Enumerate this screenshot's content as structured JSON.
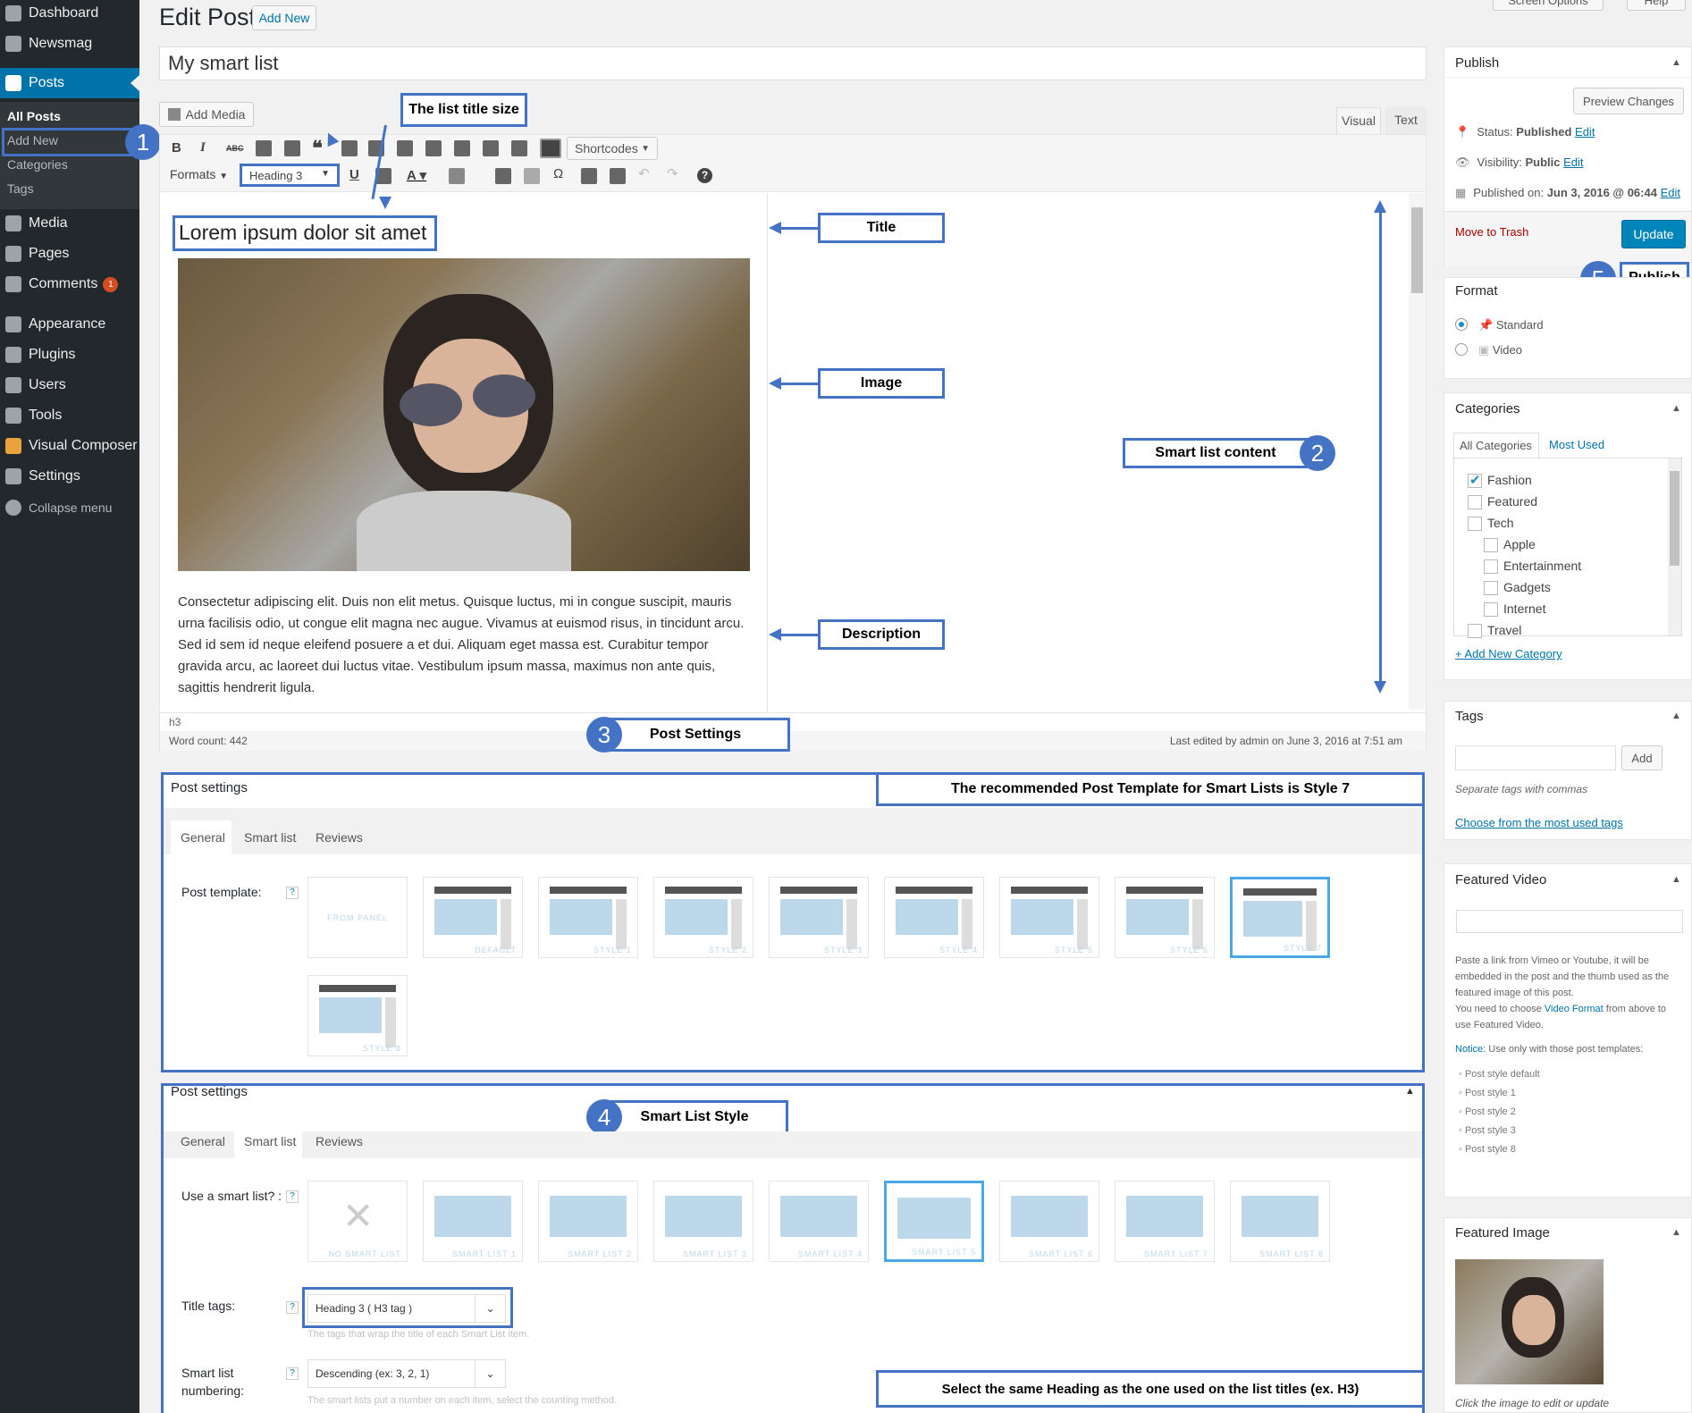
{
  "sidebar": {
    "items": [
      {
        "label": "Dashboard",
        "icon": "dashboard-icon"
      },
      {
        "label": "Newsmag",
        "icon": "newsmag-icon"
      },
      {
        "label": "Posts",
        "icon": "pin-icon"
      },
      {
        "label": "Media",
        "icon": "media-icon"
      },
      {
        "label": "Pages",
        "icon": "pages-icon"
      },
      {
        "label": "Comments",
        "icon": "comments-icon",
        "badge": "1"
      },
      {
        "label": "Appearance",
        "icon": "appearance-icon"
      },
      {
        "label": "Plugins",
        "icon": "plugins-icon"
      },
      {
        "label": "Users",
        "icon": "users-icon"
      },
      {
        "label": "Tools",
        "icon": "tools-icon"
      },
      {
        "label": "Visual Composer",
        "icon": "visual-composer-icon"
      },
      {
        "label": "Settings",
        "icon": "settings-icon"
      },
      {
        "label": "Collapse menu",
        "icon": "collapse-icon"
      }
    ],
    "submenu": [
      "All Posts",
      "Add New",
      "Categories",
      "Tags"
    ]
  },
  "header": {
    "title": "Edit Post",
    "add_new": "Add New",
    "screen_options": "Screen Options",
    "help": "Help"
  },
  "editor": {
    "post_title": "My smart list",
    "add_media": "Add Media",
    "tab_visual": "Visual",
    "tab_text": "Text",
    "shortcodes": "Shortcodes",
    "formats": "Formats",
    "heading_select": "Heading 3",
    "content_heading": "Lorem ipsum dolor sit amet",
    "paragraph": "Consectetur adipiscing elit. Duis non elit metus. Quisque luctus, mi in congue suscipit, mauris urna facilisis odio, ut congue elit magna nec augue. Vivamus at euismod risus, in tincidunt arcu. Sed id sem id neque eleifend posuere a et dui. Aliquam eget massa est. Curabitur tempor gravida arcu, ac laoreet dui luctus vitae. Vestibulum ipsum massa, maximus non ante quis, sagittis hendrerit ligula.",
    "path": "h3",
    "word_count": "Word count: 442",
    "last_edited": "Last edited by admin on June 3, 2016 at 7:51 am"
  },
  "callouts": {
    "title_size": "The list title size",
    "title": "Title",
    "image": "Image",
    "description": "Description",
    "smart_list_content": "Smart list content",
    "post_settings": "Post Settings",
    "recommended": "The recommended Post Template for Smart Lists is Style 7",
    "smart_list_style": "Smart List Style",
    "publish": "Publish",
    "select_heading": "Select the same Heading as the one used on the list titles (ex. H3)",
    "n1": "1",
    "n2": "2",
    "n3": "3",
    "n4": "4",
    "n5": "5"
  },
  "post_settings_1": {
    "title": "Post settings",
    "tabs": [
      "General",
      "Smart list",
      "Reviews"
    ],
    "post_template_label": "Post template:",
    "help": "?",
    "templates": [
      "FROM PANEL",
      "DEFAULT",
      "STYLE 1",
      "STYLE 2",
      "STYLE 3",
      "STYLE 4",
      "STYLE 5",
      "STYLE 6",
      "STYLE 7",
      "STYLE 8"
    ]
  },
  "post_settings_2": {
    "title": "Post settings",
    "tabs": [
      "General",
      "Smart list",
      "Reviews"
    ],
    "use_smart_list_label": "Use a smart list? :",
    "smart_lists": [
      "NO SMART LIST",
      "SMART LIST 1",
      "SMART LIST 2",
      "SMART LIST 3",
      "SMART LIST 4",
      "SMART LIST 5",
      "SMART LIST 6",
      "SMART LIST 7",
      "SMART LIST 8"
    ],
    "title_tags_label": "Title tags:",
    "title_tags_value": "Heading 3 ( H3 tag )",
    "title_tags_help": "The tags that wrap the title of each Smart List item.",
    "numbering_label_1": "Smart list",
    "numbering_label_2": "numbering:",
    "numbering_value": "Descending (ex: 3, 2, 1)",
    "numbering_help": "The smart lists put a number on each item, select the counting method."
  },
  "publish_box": {
    "title": "Publish",
    "preview": "Preview Changes",
    "status_label": "Status:",
    "status_value": "Published",
    "edit": "Edit",
    "visibility_label": "Visibility:",
    "visibility_value": "Public",
    "published_label": "Published on:",
    "published_value": "Jun 3, 2016 @ 06:44",
    "trash": "Move to Trash",
    "update": "Update"
  },
  "format_box": {
    "title": "Format",
    "options": [
      "Standard",
      "Video"
    ]
  },
  "categories_box": {
    "title": "Categories",
    "tab_all": "All Categories",
    "tab_most": "Most Used",
    "items": [
      {
        "label": "Fashion",
        "checked": true,
        "child": false
      },
      {
        "label": "Featured",
        "checked": false,
        "child": false
      },
      {
        "label": "Tech",
        "checked": false,
        "child": false
      },
      {
        "label": "Apple",
        "checked": false,
        "child": true
      },
      {
        "label": "Entertainment",
        "checked": false,
        "child": true
      },
      {
        "label": "Gadgets",
        "checked": false,
        "child": true
      },
      {
        "label": "Internet",
        "checked": false,
        "child": true
      },
      {
        "label": "Travel",
        "checked": false,
        "child": false
      }
    ],
    "add_new": "+ Add New Category"
  },
  "tags_box": {
    "title": "Tags",
    "add": "Add",
    "hint": "Separate tags with commas",
    "choose": "Choose from the most used tags"
  },
  "video_box": {
    "title": "Featured Video",
    "desc": "Paste a link from Vimeo or Youtube, it will be embedded in the post and the thumb used as the featured image of this post.",
    "need1": "You need to choose ",
    "need_link": "Video Format",
    "need2": " from above to use Featured Video.",
    "notice_label": "Notice:",
    "notice_text": " Use only with those post templates:",
    "list": [
      "Post style default",
      "Post style 1",
      "Post style 2",
      "Post style 3",
      "Post style 8"
    ]
  },
  "image_box": {
    "title": "Featured Image",
    "caption": "Click the image to edit or update"
  },
  "colors": {
    "accent": "#0073aa",
    "callout": "#4472c4",
    "sidebar": "#23282d"
  }
}
